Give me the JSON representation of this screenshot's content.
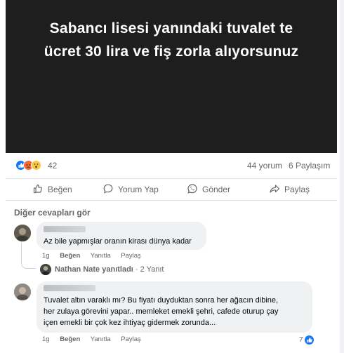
{
  "post": {
    "headline_line1": "Sabancı lisesi yanındaki tuvalet te",
    "headline_line2": "ücret 30 lira ve fiş zorla alıyorsunuz"
  },
  "stats": {
    "reaction_icons": [
      "like-icon",
      "angry-icon",
      "wow-icon"
    ],
    "reaction_count": "42",
    "comments": "44 yorum",
    "shares": "6 Paylaşım"
  },
  "actions": {
    "like": "Beğen",
    "comment": "Yorum Yap",
    "send": "Gönder",
    "share": "Paylaş"
  },
  "more_replies": "Diğer cevapları gör",
  "comments": [
    {
      "text": "Az bile yapmışlar oranın kirası dünya kadar",
      "time": "1g",
      "like": "Beğen",
      "reply": "Yanıtla",
      "share": "Paylaş"
    },
    {
      "lines": [
        "Tuvalet altın varaklı mı? Bu fiyatı duyduktan sonra her ağacın dibine,",
        "her zulaya görevini yapar.. memleket emekli şehri, cafede oturup çay",
        "içen emekli bir çok kez ihtiyaç gidermek zorunda..."
      ],
      "time": "1g",
      "like": "Beğen",
      "reply": "Yanıtla",
      "share": "Paylaş",
      "like_count": "7"
    }
  ],
  "reply_summary": {
    "name": "Nathan Nate yanıtladı",
    "count": "· 2 Yanıt"
  },
  "colors": {
    "brand_blue": "#1877f2",
    "muted_text": "#65676b",
    "bubble_bg": "#eff1f3"
  }
}
